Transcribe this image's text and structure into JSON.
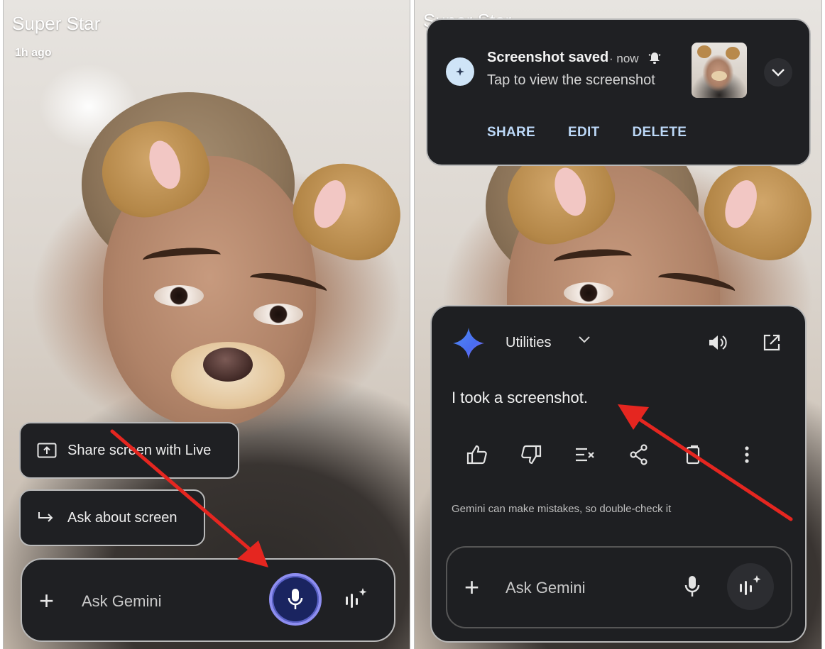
{
  "left_screen": {
    "contact_name": "Super Star",
    "posted_time": "1h ago",
    "chips": [
      {
        "label": "Share screen with Live",
        "icon": "share-screen-icon"
      },
      {
        "label": "Ask about screen",
        "icon": "redirect-arrow-icon"
      }
    ],
    "input": {
      "placeholder": "Ask Gemini",
      "plus_icon": "plus-icon",
      "mic_icon": "mic-icon",
      "live_icon": "gemini-live-icon"
    }
  },
  "right_screen": {
    "notification": {
      "title": "Screenshot saved",
      "time": "· now",
      "body": "Tap to view the screenshot",
      "actions": [
        "SHARE",
        "EDIT",
        "DELETE"
      ],
      "app_icon": "gemini-small-icon",
      "bell_icon": "bell-icon",
      "expand_icon": "chevron-down-icon"
    },
    "gemini": {
      "title": "Utilities",
      "response": "I took a screenshot.",
      "disclaimer": "Gemini can make mistakes, so double-check it",
      "actions": [
        "thumbs-up-icon",
        "thumbs-down-icon",
        "modify-response-icon",
        "share-icon",
        "copy-icon",
        "more-icon"
      ],
      "input_placeholder": "Ask Gemini"
    }
  },
  "colors": {
    "panel_bg": "#1f2023",
    "border": "#b9b9b9",
    "mic_ring": "#8d8df0",
    "notif_action": "#bcd8f7",
    "arrow": "#e52620"
  }
}
